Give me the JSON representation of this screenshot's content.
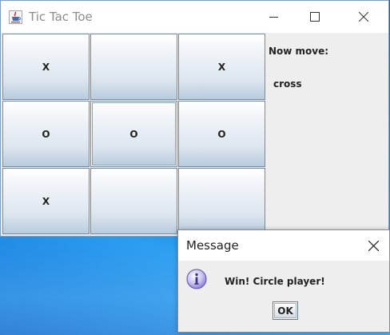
{
  "window": {
    "title": "Tic Tac Toe",
    "icon": "java-cup-icon"
  },
  "board": {
    "cells": [
      "X",
      "",
      "X",
      "O",
      "O",
      "O",
      "X",
      "",
      ""
    ],
    "focused_cell": 4
  },
  "status": {
    "label": "Now move:",
    "value": "cross"
  },
  "dialog": {
    "title": "Message",
    "icon": "info-icon",
    "message": "Win! Circle player!",
    "ok_label": "OK"
  },
  "colors": {
    "desktop": "#1a78d4",
    "window_bg": "#eeeeee",
    "titlebar": "#ffffff"
  }
}
